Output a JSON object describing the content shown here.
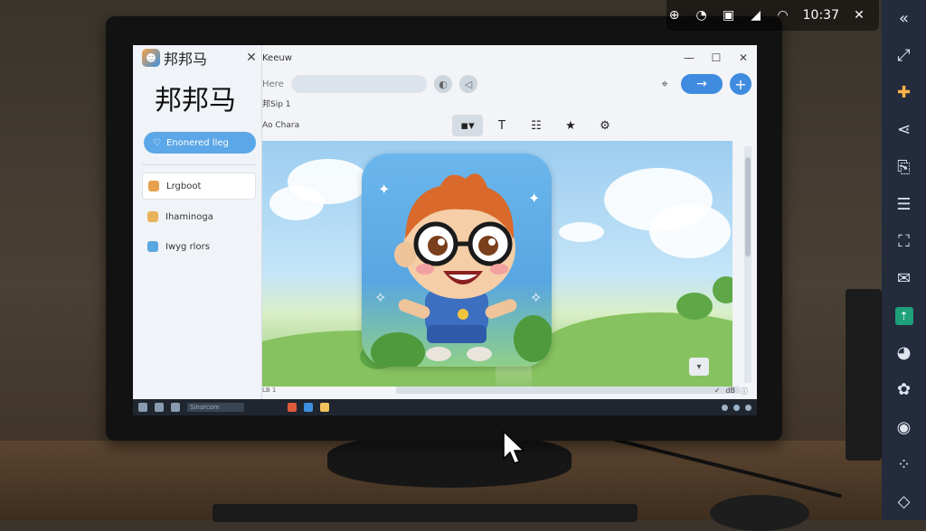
{
  "android_status": {
    "time": "10:37",
    "icons": [
      "alarm-icon",
      "clock-icon",
      "wallet-icon",
      "signal-icon",
      "wifi-icon"
    ],
    "close_symbol": "✕"
  },
  "emulator_sidebar": {
    "buttons": [
      {
        "name": "collapse-icon",
        "glyph": "«"
      },
      {
        "name": "resize-icon",
        "glyph": "⤢"
      },
      {
        "name": "gamepad-icon",
        "glyph": "✚"
      },
      {
        "name": "share-icon",
        "glyph": "⋖"
      },
      {
        "name": "import-file-icon",
        "glyph": "⎘"
      },
      {
        "name": "notes-icon",
        "glyph": "☰"
      },
      {
        "name": "fullscreen-icon",
        "glyph": "⛶"
      },
      {
        "name": "screenshot-icon",
        "glyph": "✉"
      },
      {
        "name": "install-apk-icon",
        "glyph": "⇡"
      },
      {
        "name": "eco-mode-icon",
        "glyph": "◕"
      },
      {
        "name": "settings-gear-icon",
        "glyph": "✿"
      },
      {
        "name": "record-icon",
        "glyph": "◉"
      },
      {
        "name": "macro-icon",
        "glyph": "⁘"
      },
      {
        "name": "rotate-icon",
        "glyph": "◇"
      }
    ]
  },
  "app_panel": {
    "app_name": "邦邦马",
    "big_title": "邦邦马",
    "feature_button": "Enonered lleg",
    "list": [
      {
        "label": "Lrgboot",
        "color": "#e6a04c"
      },
      {
        "label": "Ihaminoga",
        "color": "#e8b35a"
      },
      {
        "label": "Iwyg rlors",
        "color": "#5aa6e0"
      }
    ]
  },
  "browser": {
    "title": "Keeuw",
    "address_label": "Here",
    "subtitle": "邦Sip 1",
    "toolbar_label": "Ao Chara",
    "status_left": "LB 1",
    "status_right": [
      "✓",
      "dB",
      "ⓘ"
    ],
    "go_arrow": "→",
    "plus": "+",
    "min": "—",
    "max": "☐",
    "close": "✕"
  },
  "taskbar": {
    "search_text": "Sinarcom"
  }
}
